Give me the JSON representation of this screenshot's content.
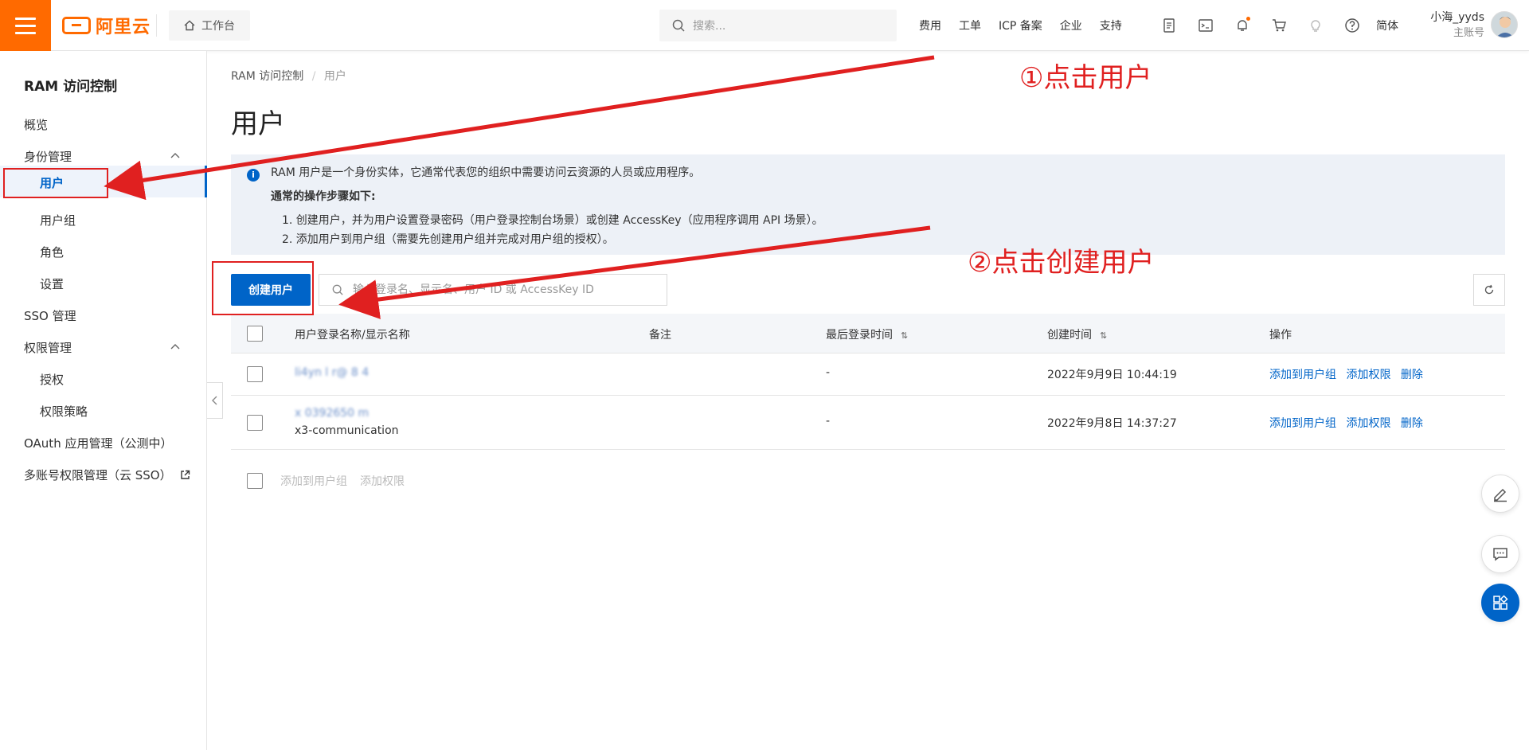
{
  "header": {
    "logo_text": "阿里云",
    "workbench": "工作台",
    "search_placeholder": "搜索...",
    "nav": [
      "费用",
      "工单",
      "ICP 备案",
      "企业",
      "支持"
    ],
    "lang": "简体",
    "user_name": "小海_yyds",
    "user_role": "主账号",
    "accent": "#ff6a00"
  },
  "sidebar": {
    "title": "RAM 访问控制",
    "items": {
      "overview": "概览",
      "identity": "身份管理",
      "users": "用户",
      "groups": "用户组",
      "roles": "角色",
      "settings": "设置",
      "sso": "SSO 管理",
      "permissions": "权限管理",
      "grants": "授权",
      "policies": "权限策略",
      "oauth": "OAuth 应用管理（公测中）",
      "multi_account": "多账号权限管理（云 SSO）"
    },
    "active_color": "#0064c8"
  },
  "main": {
    "breadcrumb": {
      "root": "RAM 访问控制",
      "sep": "/",
      "current": "用户"
    },
    "title": "用户",
    "notice": {
      "line1": "RAM 用户是一个身份实体，它通常代表您的组织中需要访问云资源的人员或应用程序。",
      "heading": "通常的操作步骤如下:",
      "step1": "1. 创建用户，并为用户设置登录密码（用户登录控制台场景）或创建 AccessKey（应用程序调用 API 场景）。",
      "step2": "2. 添加用户到用户组（需要先创建用户组并完成对用户组的授权）。"
    },
    "create_button": "创建用户",
    "table_search_placeholder": "输入登录名、显示名、用户 ID 或 AccessKey ID",
    "columns": {
      "name": "用户登录名称/显示名称",
      "remark": "备注",
      "last_login": "最后登录时间",
      "created": "创建时间",
      "actions": "操作"
    },
    "rows": [
      {
        "name": "li4yn l r@ 8 4",
        "display": "",
        "remark": "",
        "last_login": "-",
        "created": "2022年9月9日 10:44:19",
        "actions": [
          "添加到用户组",
          "添加权限",
          "删除"
        ]
      },
      {
        "name": "x 0392650 m",
        "display": "x3-communication",
        "remark": "",
        "last_login": "-",
        "created": "2022年9月8日 14:37:27",
        "actions": [
          "添加到用户组",
          "添加权限",
          "删除"
        ]
      }
    ],
    "batch": {
      "add_group": "添加到用户组",
      "add_perm": "添加权限"
    }
  },
  "annotations": {
    "step1": "①点击用户",
    "step2": "②点击创建用户",
    "color": "#e02020"
  }
}
